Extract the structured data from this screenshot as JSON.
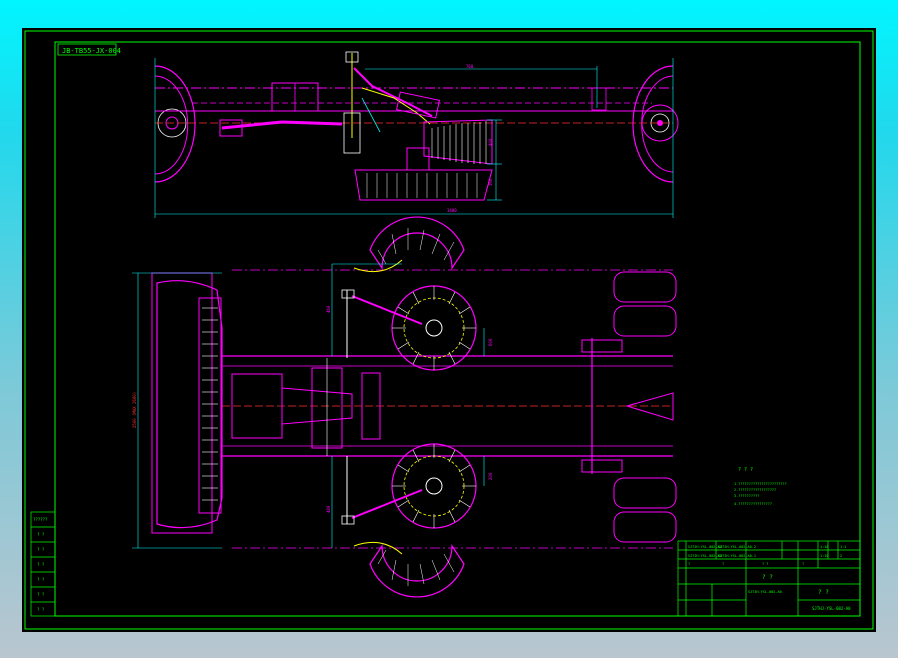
{
  "drawing": {
    "code_tag": "JB-TB55-JX-004",
    "title_cn": "? ?",
    "title_block": {
      "part_name": "? ?",
      "drawing_no": "SJTHJ-YSL-002-A0",
      "row1_left": "SJTJH-YSL-002-A0",
      "row1_mid": "SJTJH-YSL-002-A0.2",
      "row2_left": "SJTJH-YSL-002-A0",
      "row2_mid": "SJTJH-YSL-002-A0.1",
      "header_cells": [
        "?",
        "?",
        "? ?",
        "?",
        "? ?",
        "?",
        "? ?",
        "?"
      ],
      "assembly_label": "SJTJH-YSL-002-A0",
      "scale_cells": [
        "1:10",
        "1:10",
        "1:1"
      ],
      "sheet_no": "2"
    },
    "notes": {
      "heading": "? ? ?",
      "lines": [
        "1.???????????????????????",
        "2.??????????????????",
        "3.??????????",
        "4.????????????????"
      ]
    },
    "revision_block": {
      "rows": [
        "??????",
        "? ?",
        "? ?",
        "? ?",
        "? ?",
        "? ?",
        "? ?"
      ]
    },
    "dimensions": {
      "top_span": "760",
      "overall_width": "3400",
      "right_upper": "400",
      "right_lower": "160",
      "plan_left_vertical": "2500 (MAX 2600)",
      "plan_upper_a": "460",
      "plan_upper_b": "600",
      "plan_lower_a": "480",
      "plan_lower_b": "200"
    },
    "colors": {
      "sheet_bg": "#000000",
      "border": "#00ff00",
      "magenta": "#ff00ff",
      "cyan": "#00ffff",
      "white": "#ffffff",
      "yellow": "#ffff00",
      "red": "#ff3030"
    }
  }
}
